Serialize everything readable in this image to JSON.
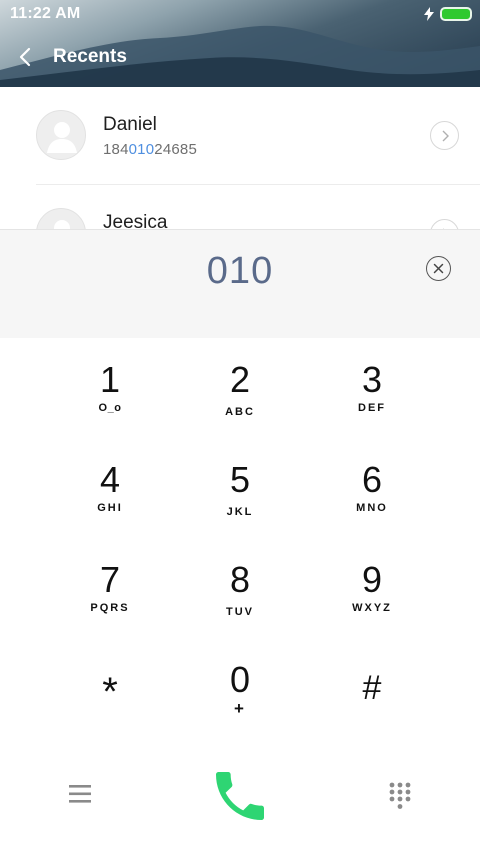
{
  "status_bar": {
    "time": "11:22 AM",
    "battery_color": "#2fc92f"
  },
  "header": {
    "title": "Recents"
  },
  "recents": [
    {
      "name": "Daniel",
      "number_parts": [
        "184",
        "010",
        "24685"
      ],
      "highlight_color": "#4f8fe0"
    },
    {
      "name": "Jeesica"
    }
  ],
  "dialer": {
    "number": "010"
  },
  "keypad": [
    {
      "digit": "1",
      "letters": "O_o"
    },
    {
      "digit": "2",
      "letters": "ABC"
    },
    {
      "digit": "3",
      "letters": "DEF"
    },
    {
      "digit": "4",
      "letters": "GHI"
    },
    {
      "digit": "5",
      "letters": "JKL"
    },
    {
      "digit": "6",
      "letters": "MNO"
    },
    {
      "digit": "7",
      "letters": "PQRS"
    },
    {
      "digit": "8",
      "letters": "TUV"
    },
    {
      "digit": "9",
      "letters": "WXYZ"
    },
    {
      "digit": "*",
      "letters": ""
    },
    {
      "digit": "0",
      "letters": "+"
    },
    {
      "digit": "#",
      "letters": ""
    }
  ],
  "icons": {
    "back": "chevron-left-icon",
    "detail": "chevron-right-icon",
    "clear": "clear-circle-icon",
    "menu": "hamburger-menu-icon",
    "call": "phone-icon",
    "dialpad": "dialpad-icon",
    "charging": "lightning-icon",
    "battery": "battery-icon"
  },
  "colors": {
    "call_green": "#2ed573",
    "dialed_number": "#5a6a8a"
  }
}
